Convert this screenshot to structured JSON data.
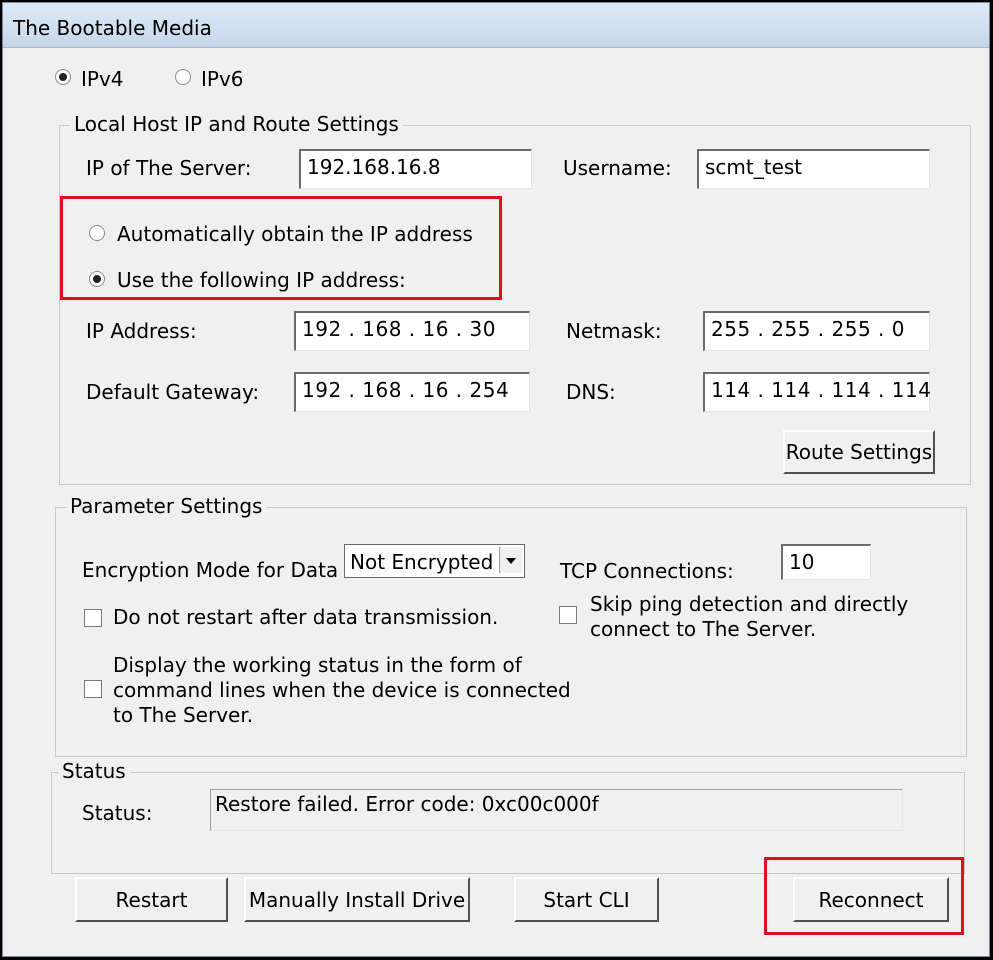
{
  "window": {
    "title": "The Bootable Media"
  },
  "ip_version": {
    "ipv4_label": "IPv4",
    "ipv6_label": "IPv6",
    "selected": "IPv4"
  },
  "local_host": {
    "legend": "Local Host IP and Route Settings",
    "server_ip_label": "IP of The Server:",
    "server_ip_value": "192.168.16.8",
    "username_label": "Username:",
    "username_value": "scmt_test",
    "auto_ip_label": "Automatically obtain the IP address",
    "manual_ip_label": "Use the following IP address:",
    "selected_mode": "manual",
    "ip_address_label": "IP Address:",
    "ip_address_value": "192 . 168  .  16   .  30",
    "netmask_label": "Netmask:",
    "netmask_value": "255 . 255 . 255 .   0",
    "gateway_label": "Default Gateway:",
    "gateway_value": "192 . 168  .  16   . 254",
    "dns_label": "DNS:",
    "dns_value": "114 . 114 . 114 . 114",
    "route_settings_button": "Route Settings"
  },
  "parameters": {
    "legend": "Parameter Settings",
    "encryption_label": "Encryption Mode for Data",
    "encryption_value": "Not Encrypted",
    "tcp_label": "TCP Connections:",
    "tcp_value": "10",
    "no_restart_label": "Do not restart after data transmission.",
    "skip_ping_line1": "Skip ping detection and directly",
    "skip_ping_line2": "connect to The Server.",
    "cli_status_line1": "Display the working status in the form of",
    "cli_status_line2": "command lines when the device is connected",
    "cli_status_line3": "to The Server."
  },
  "status": {
    "legend": "Status",
    "label": "Status:",
    "value": "Restore failed. Error code: 0xc00c000f"
  },
  "buttons": {
    "restart": "Restart",
    "install_drive": "Manually Install Drive",
    "start_cli": "Start CLI",
    "reconnect": "Reconnect"
  },
  "colors": {
    "highlight": "#e0101e",
    "titlebar": "#c6d7ec"
  }
}
